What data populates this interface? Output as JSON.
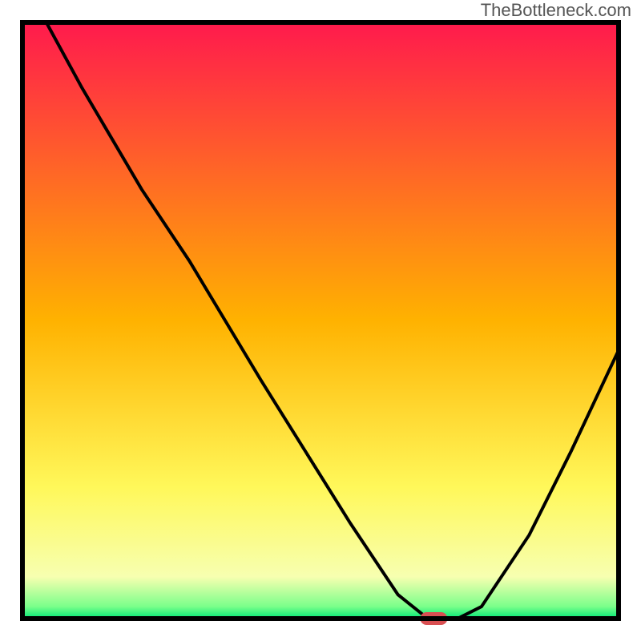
{
  "watermark": "TheBottleneck.com",
  "chart_data": {
    "type": "line",
    "title": "",
    "xlabel": "",
    "ylabel": "",
    "xlim": [
      0,
      100
    ],
    "ylim": [
      0,
      100
    ],
    "grid": false,
    "background": {
      "type": "gradient",
      "stops": [
        {
          "offset": 0.0,
          "color": "#ff1a4d"
        },
        {
          "offset": 0.5,
          "color": "#ffb200"
        },
        {
          "offset": 0.78,
          "color": "#fff85a"
        },
        {
          "offset": 0.93,
          "color": "#f7ffb0"
        },
        {
          "offset": 0.98,
          "color": "#7aff8a"
        },
        {
          "offset": 1.0,
          "color": "#00e676"
        }
      ]
    },
    "series": [
      {
        "name": "bottleneck-curve",
        "color": "#000000",
        "x": [
          4,
          10,
          20,
          28,
          40,
          55,
          63,
          68,
          73,
          77,
          85,
          92,
          100
        ],
        "y": [
          100,
          89,
          72,
          60,
          40,
          16,
          4,
          0,
          0,
          2,
          14,
          28,
          45
        ]
      }
    ],
    "marker": {
      "name": "optimal-point",
      "x": 69,
      "y": 0,
      "color": "#d94f52",
      "shape": "pill"
    },
    "frame": {
      "stroke": "#000000",
      "strokeWidth": 6
    }
  }
}
